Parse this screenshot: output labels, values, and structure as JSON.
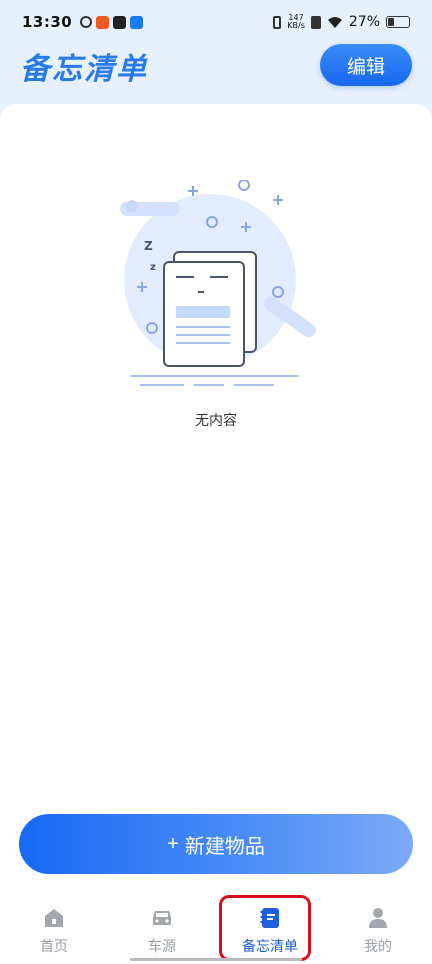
{
  "status_bar": {
    "time": "13:30",
    "net_speed_value": "147",
    "net_speed_unit": "KB/s",
    "battery": "27%"
  },
  "header": {
    "title": "备忘清单",
    "edit_label": "编辑"
  },
  "empty_state": {
    "text": "无内容"
  },
  "actions": {
    "new_item_label": "新建物品",
    "new_item_prefix": "+"
  },
  "tabbar": {
    "tabs": [
      {
        "label": "首页",
        "icon": "home-icon"
      },
      {
        "label": "车源",
        "icon": "car-icon"
      },
      {
        "label": "备忘清单",
        "icon": "notebook-icon",
        "active": true
      },
      {
        "label": "我的",
        "icon": "user-icon"
      }
    ]
  },
  "colors": {
    "accent": "#1f6ff0",
    "tab_active": "#1f5fd8",
    "tab_inactive": "#9aa0a6",
    "highlight": "#d4111a"
  }
}
